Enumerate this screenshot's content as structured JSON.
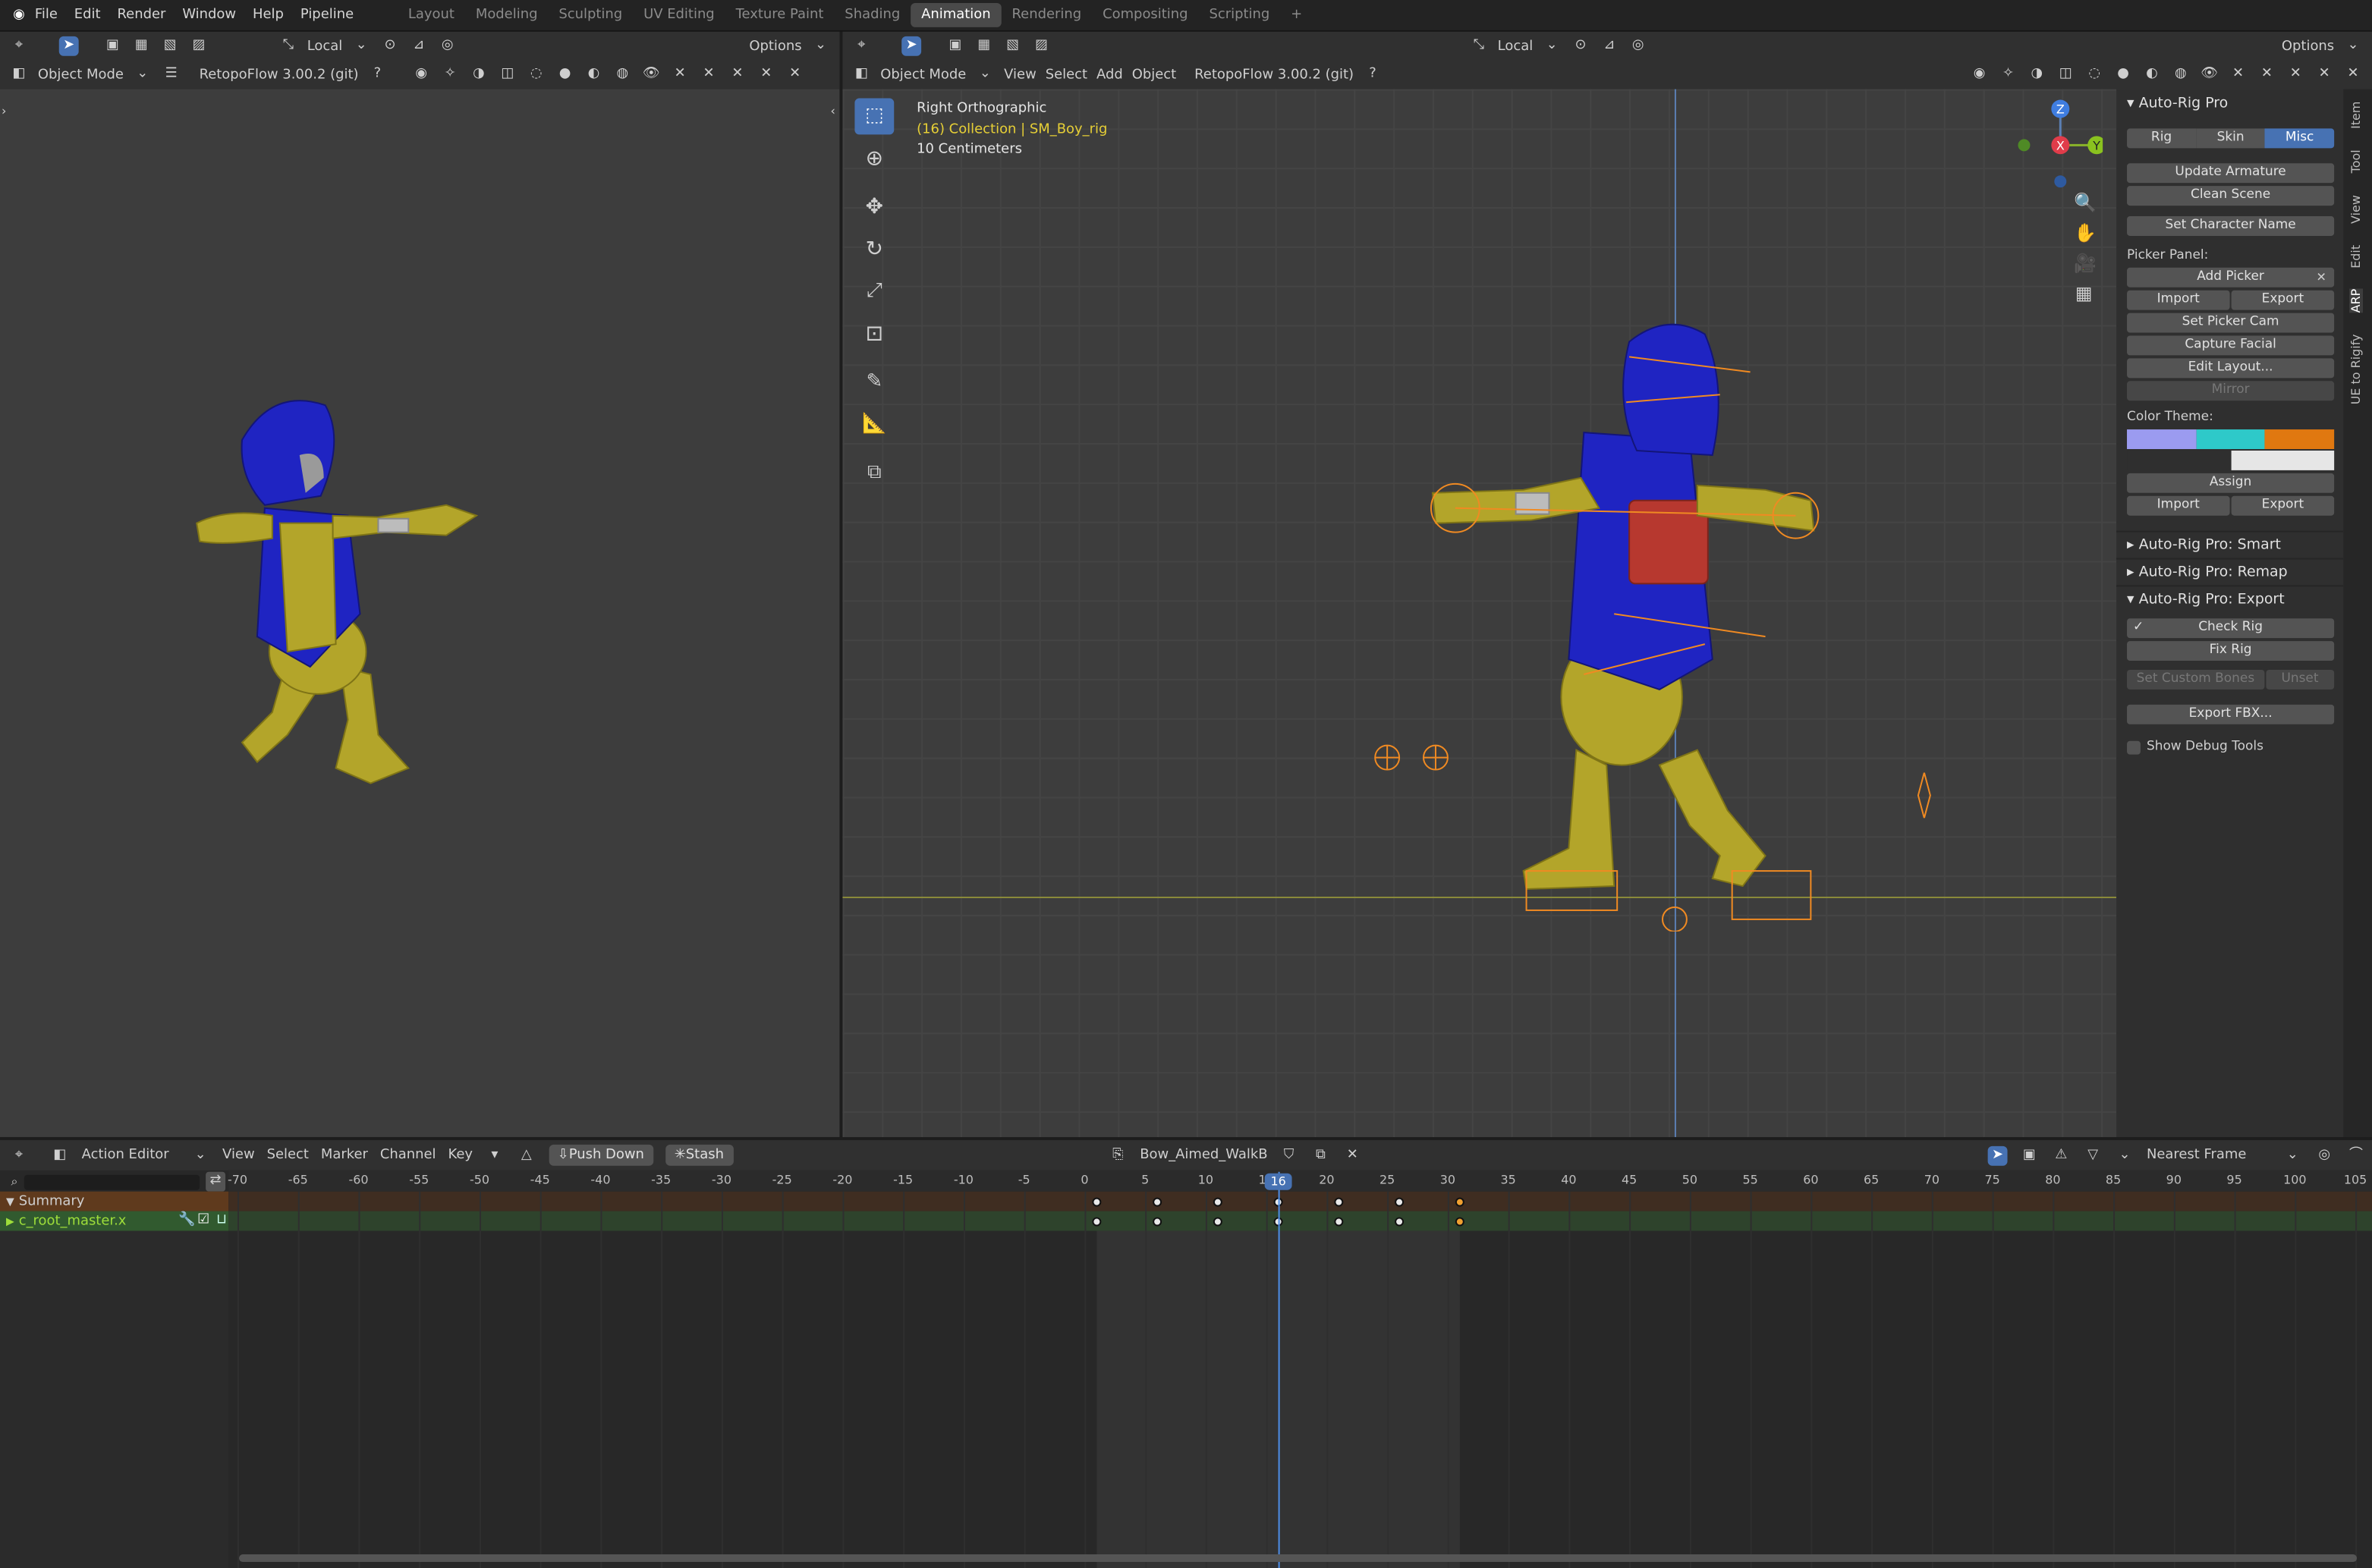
{
  "topbar": {
    "menus": [
      "File",
      "Edit",
      "Render",
      "Window",
      "Help",
      "Pipeline"
    ],
    "workspaces": [
      "Layout",
      "Modeling",
      "Sculpting",
      "UV Editing",
      "Texture Paint",
      "Shading",
      "Animation",
      "Rendering",
      "Compositing",
      "Scripting"
    ],
    "active_workspace": "Animation",
    "add_tab": "+",
    "options": "Options"
  },
  "left_viewport": {
    "mode": "Object Mode",
    "addon": "RetopoFlow 3.00.2 (git)",
    "orientation": "Local",
    "options": "Options"
  },
  "right_viewport": {
    "mode": "Object Mode",
    "menus": [
      "View",
      "Select",
      "Add",
      "Object"
    ],
    "addon": "RetopoFlow 3.00.2 (git)",
    "orientation": "Local",
    "options": "Options",
    "view_name": "Right Orthographic",
    "collection": "(16) Collection | SM_Boy_rig",
    "scale": "10 Centimeters",
    "gizmo": {
      "z": "Z",
      "x": "X",
      "y": "Y"
    }
  },
  "panel": {
    "title": "Auto-Rig Pro",
    "tabs": [
      "Rig",
      "Skin",
      "Misc"
    ],
    "active_tab": "Misc",
    "update_armature": "Update Armature",
    "clean_scene": "Clean Scene",
    "set_character_name": "Set Character Name",
    "picker_label": "Picker Panel:",
    "add_picker": "Add Picker",
    "import": "Import",
    "export": "Export",
    "set_picker_cam": "Set Picker Cam",
    "capture_facial": "Capture Facial",
    "edit_layout": "Edit Layout...",
    "mirror": "Mirror",
    "color_theme": "Color Theme:",
    "theme_colors": [
      "#9b9bf0",
      "#2ec9c9",
      "#e07810",
      "#2f2f2f",
      "#e6e6e6"
    ],
    "assign": "Assign",
    "import2": "Import",
    "export2": "Export",
    "sec_smart": "Auto-Rig Pro: Smart",
    "sec_remap": "Auto-Rig Pro: Remap",
    "sec_export": "Auto-Rig Pro: Export",
    "check_rig": "Check Rig",
    "fix_rig": "Fix Rig",
    "set_custom_bones": "Set Custom Bones",
    "unset": "Unset",
    "export_fbx": "Export FBX...",
    "show_debug": "Show Debug Tools"
  },
  "vtabs": [
    "Item",
    "Tool",
    "View",
    "Edit",
    "ARP",
    "UE to Rigify"
  ],
  "action_editor": {
    "mode": "Action Editor",
    "menus": [
      "View",
      "Select",
      "Marker",
      "Channel",
      "Key"
    ],
    "push_down": "Push Down",
    "stash": "Stash",
    "action_name": "Bow_Aimed_WalkB...",
    "snap": "Nearest Frame",
    "current_frame": 16,
    "ruler_labels": [
      "-70",
      "-65",
      "-60",
      "-55",
      "-50",
      "-45",
      "-40",
      "-35",
      "-30",
      "-25",
      "-20",
      "-15",
      "-10",
      "-5",
      "0",
      "5",
      "10",
      "15",
      "20",
      "25",
      "30",
      "35",
      "40",
      "45",
      "50",
      "55",
      "60",
      "65",
      "70",
      "75",
      "80",
      "85",
      "90",
      "95",
      "100",
      "105"
    ],
    "channels": [
      {
        "name": "Summary"
      },
      {
        "name": "c_root_master.x"
      }
    ],
    "keyframes": [
      1,
      6,
      11,
      16,
      21,
      26,
      31
    ],
    "selected_keyframes": [
      31
    ]
  }
}
